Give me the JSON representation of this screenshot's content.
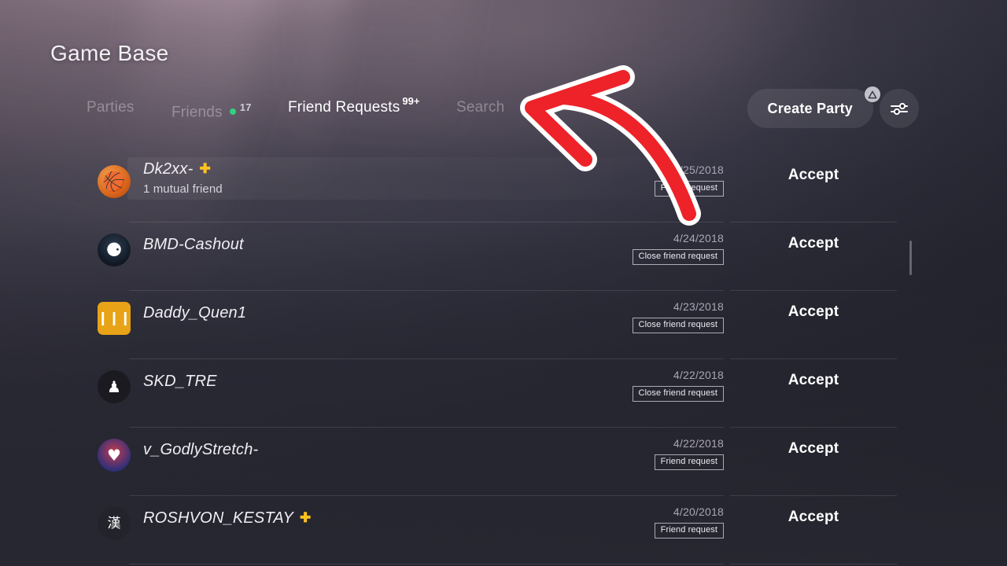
{
  "app": {
    "title": "Game Base"
  },
  "tabs": [
    {
      "id": "parties",
      "label": "Parties",
      "active": false
    },
    {
      "id": "friends",
      "label": "Friends",
      "active": false,
      "count": "17",
      "status_dot": "online-green"
    },
    {
      "id": "requests",
      "label": "Friend Requests",
      "active": true,
      "badge": "99+"
    },
    {
      "id": "search",
      "label": "Search",
      "active": false
    }
  ],
  "toolbar": {
    "create_party_label": "Create Party",
    "triangle_badge_icon": "playstation-triangle-icon",
    "filter_icon": "sliders-filter-icon"
  },
  "colors": {
    "accent_green": "#35d07f",
    "ps_plus_gold": "#ffc220",
    "annotation_red": "#ee2229",
    "annotation_outline": "#ffffff",
    "background_dark": "#25252f"
  },
  "list": {
    "rows": [
      {
        "username": "Dk2xx-",
        "ps_plus": true,
        "subtitle": "1 mutual friend",
        "date": "4/25/2018",
        "badge": "Friend request",
        "avatar_icon": "basketball-avatar",
        "avatar_glyph": "🏀",
        "avatar_class": "av-ball",
        "highlighted": true,
        "accept_label": "Accept"
      },
      {
        "username": "BMD-Cashout",
        "ps_plus": false,
        "subtitle": "",
        "date": "4/24/2018",
        "badge": "Close friend request",
        "avatar_icon": "robot-face-avatar",
        "avatar_glyph": "⚈",
        "avatar_class": "av-robot",
        "highlighted": false,
        "accept_label": "Accept"
      },
      {
        "username": "Daddy_Quen1",
        "ps_plus": false,
        "subtitle": "",
        "date": "4/23/2018",
        "badge": "Close friend request",
        "avatar_icon": "gold-card-avatar",
        "avatar_glyph": "❙❙❙",
        "avatar_class": "av-gold",
        "highlighted": false,
        "accept_label": "Accept"
      },
      {
        "username": "SKD_TRE",
        "ps_plus": false,
        "subtitle": "",
        "date": "4/22/2018",
        "badge": "Close friend request",
        "avatar_icon": "hooded-figure-avatar",
        "avatar_glyph": "♟",
        "avatar_class": "av-figure",
        "highlighted": false,
        "accept_label": "Accept"
      },
      {
        "username": "v_GodlyStretch-",
        "ps_plus": false,
        "subtitle": "",
        "date": "4/22/2018",
        "badge": "Friend request",
        "avatar_icon": "woman-portrait-avatar",
        "avatar_glyph": "♥",
        "avatar_class": "av-woman",
        "highlighted": false,
        "accept_label": "Accept"
      },
      {
        "username": "ROSHVON_KESTAY",
        "ps_plus": true,
        "subtitle": "",
        "date": "4/20/2018",
        "badge": "Friend request",
        "avatar_icon": "kanji-avatar",
        "avatar_glyph": "漢",
        "avatar_class": "av-kanji",
        "highlighted": false,
        "accept_label": "Accept"
      }
    ]
  },
  "annotation": {
    "type": "hand-drawn-arrow",
    "direction": "points-left",
    "color": "#ee2229"
  }
}
